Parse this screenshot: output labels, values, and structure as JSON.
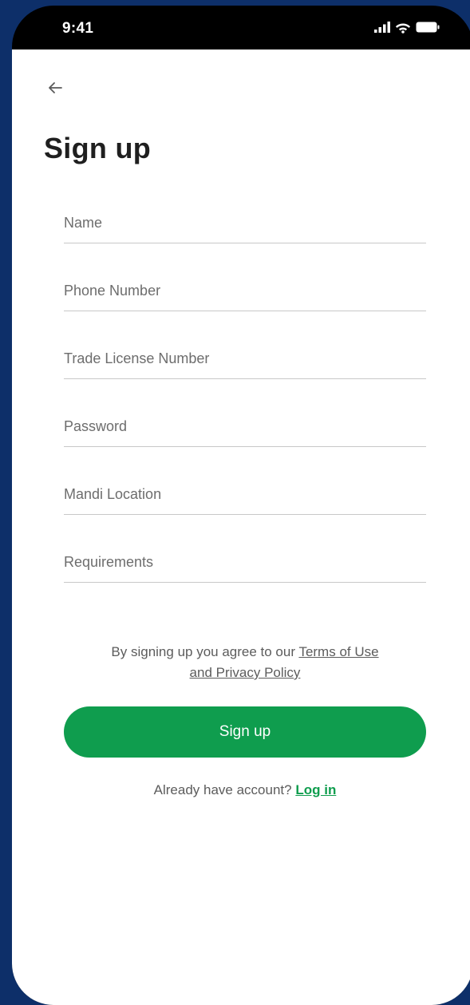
{
  "status_bar": {
    "time": "9:41"
  },
  "header": {
    "back_icon": "arrow-left-icon",
    "title": "Sign up"
  },
  "form": {
    "fields": [
      {
        "name": "name",
        "placeholder": "Name",
        "value": ""
      },
      {
        "name": "phone",
        "placeholder": "Phone Number",
        "value": ""
      },
      {
        "name": "trade_license",
        "placeholder": "Trade License Number",
        "value": ""
      },
      {
        "name": "password",
        "placeholder": "Password",
        "value": ""
      },
      {
        "name": "mandi_location",
        "placeholder": "Mandi Location",
        "value": ""
      },
      {
        "name": "requirements",
        "placeholder": "Requirements",
        "value": ""
      }
    ]
  },
  "terms": {
    "prefix": "By signing up you agree to our",
    "link_part1": "Terms of Use",
    "link_part2": "and Privacy Policy"
  },
  "actions": {
    "signup_label": "Sign up",
    "login_prompt": "Already have account?",
    "login_link": "Log in"
  },
  "colors": {
    "background": "#0d2f69",
    "accent": "#0f9d4e",
    "text": "#1f1f1f",
    "muted": "#5c5c5c"
  }
}
